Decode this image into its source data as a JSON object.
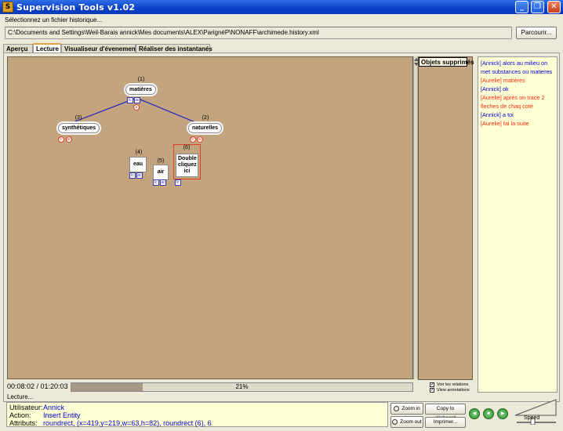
{
  "window": {
    "title": "Supervision Tools v1.02",
    "icon_letter": "S",
    "min": "_",
    "max": "❐",
    "close": "✕"
  },
  "file": {
    "label": "Sélectionnez un fichier historique...",
    "path": "C:\\Documents and Settings\\Weil-Barais annick\\Mes documents\\ALEX\\ParignéP\\NONAFF\\archimede.history.xml",
    "browse": "Parcourir..."
  },
  "tabs": [
    {
      "label": "Aperçu"
    },
    {
      "label": "Lecture"
    },
    {
      "label": "Visualiseur d'évenement"
    },
    {
      "label": "Réaliser des instantanés"
    }
  ],
  "diagram": {
    "nodes": [
      {
        "num": "(1)",
        "label": "matières"
      },
      {
        "num": "(3)",
        "label": "synthétiques"
      },
      {
        "num": "(2)",
        "label": "naturelles"
      },
      {
        "num": "(4)",
        "label": "eau"
      },
      {
        "num": "(5)",
        "label": "air"
      },
      {
        "num": "(6)",
        "label": "Double cliquez ici"
      }
    ],
    "mini": {
      "lc": "lc",
      "ac": "ac",
      "a": "a"
    }
  },
  "objects_panel": {
    "title": "Objets supprimés"
  },
  "chat": [
    {
      "text": "[Annick] alors au milieu on met substances ou matieres",
      "color": "blue"
    },
    {
      "text": "[Aurelie] matières",
      "color": "red"
    },
    {
      "text": "[Annick] ok",
      "color": "blue"
    },
    {
      "text": "[Aurelie] après on trace 2 fleches de chaq coté",
      "color": "red"
    },
    {
      "text": "[Annick] a toi",
      "color": "blue"
    },
    {
      "text": "[Aurelie] fai la suite",
      "color": "red"
    }
  ],
  "playback": {
    "time": "00:08:02 / 01:20:03",
    "progress": 0.21,
    "progress_text": "21%",
    "show_relations": "Voir les relations",
    "view_annotations": "View annotations"
  },
  "info": {
    "status": "Lecture...",
    "user_label": "Utilisateur:",
    "user": "Annick",
    "action_label": "Action:",
    "action": "Insert Entity",
    "attr_label": "Attributs:",
    "attributes": "roundrect, (x=419,y=219,w=63,h=82), roundrect (6), 6"
  },
  "buttons": {
    "zoom_in": "Zoom in",
    "zoom_out": "Zoom out",
    "copy": "Copy to clipboard",
    "print": "Imprimer...",
    "speed": "Speed"
  },
  "colors": {
    "canvas": "#c2a57f",
    "chat_bg": "#ffffd6",
    "link": "#2020c0",
    "selected": "#e04020",
    "title_bar": "#0a3fc8"
  }
}
